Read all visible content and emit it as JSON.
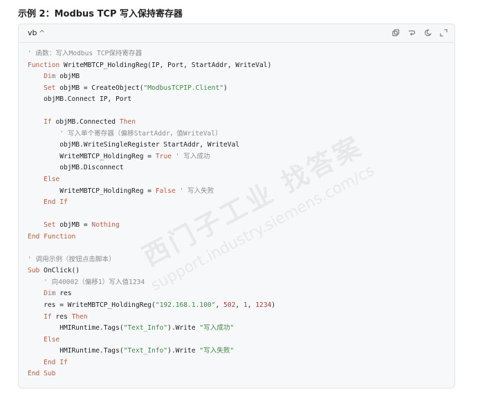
{
  "heading": "示例 2：Modbus TCP 写入保持寄存器",
  "code_block": {
    "language": "vb",
    "collapse_icon": "chevron-up-icon",
    "actions": [
      {
        "name": "copy-icon"
      },
      {
        "name": "wrap-icon"
      },
      {
        "name": "theme-icon"
      },
      {
        "name": "expand-icon"
      }
    ],
    "lines": [
      [
        {
          "t": "' 函数：写入Modbus TCP保持寄存器",
          "c": "cm"
        }
      ],
      [
        {
          "t": "Function",
          "c": "kw"
        },
        {
          "t": " WriteMBTCP_HoldingReg(IP, Port, StartAddr, WriteVal)",
          "c": ""
        }
      ],
      [
        {
          "t": "    ",
          "c": ""
        },
        {
          "t": "Dim",
          "c": "kw"
        },
        {
          "t": " objMB",
          "c": ""
        }
      ],
      [
        {
          "t": "    ",
          "c": ""
        },
        {
          "t": "Set",
          "c": "kw"
        },
        {
          "t": " objMB = CreateObject(",
          "c": ""
        },
        {
          "t": "\"ModbusTCPIP.Client\"",
          "c": "st"
        },
        {
          "t": ")",
          "c": ""
        }
      ],
      [
        {
          "t": "    objMB.Connect IP, Port",
          "c": ""
        }
      ],
      [
        {
          "t": "",
          "c": ""
        }
      ],
      [
        {
          "t": "    ",
          "c": ""
        },
        {
          "t": "If",
          "c": "kw"
        },
        {
          "t": " objMB.Connected ",
          "c": ""
        },
        {
          "t": "Then",
          "c": "kw"
        }
      ],
      [
        {
          "t": "        ' 写入单个寄存器（偏移StartAddr，值WriteVal）",
          "c": "cm"
        }
      ],
      [
        {
          "t": "        objMB.WriteSingleRegister StartAddr, WriteVal",
          "c": ""
        }
      ],
      [
        {
          "t": "        WriteMBTCP_HoldingReg = ",
          "c": ""
        },
        {
          "t": "True",
          "c": "kw"
        },
        {
          "t": " ' 写入成功",
          "c": "cm"
        }
      ],
      [
        {
          "t": "        objMB.Disconnect",
          "c": ""
        }
      ],
      [
        {
          "t": "    ",
          "c": ""
        },
        {
          "t": "Else",
          "c": "kw"
        }
      ],
      [
        {
          "t": "        WriteMBTCP_HoldingReg = ",
          "c": ""
        },
        {
          "t": "False",
          "c": "kw"
        },
        {
          "t": " ' 写入失败",
          "c": "cm"
        }
      ],
      [
        {
          "t": "    ",
          "c": ""
        },
        {
          "t": "End If",
          "c": "kw"
        }
      ],
      [
        {
          "t": "",
          "c": ""
        }
      ],
      [
        {
          "t": "    ",
          "c": ""
        },
        {
          "t": "Set",
          "c": "kw"
        },
        {
          "t": " objMB = ",
          "c": ""
        },
        {
          "t": "Nothing",
          "c": "kw"
        }
      ],
      [
        {
          "t": "End Function",
          "c": "kw"
        }
      ],
      [
        {
          "t": "",
          "c": ""
        }
      ],
      [
        {
          "t": "' 调用示例（按钮点击脚本）",
          "c": "cm"
        }
      ],
      [
        {
          "t": "Sub",
          "c": "kw"
        },
        {
          "t": " OnClick()",
          "c": ""
        }
      ],
      [
        {
          "t": "    ' 向40002（偏移1）写入值1234",
          "c": "cm"
        }
      ],
      [
        {
          "t": "    ",
          "c": ""
        },
        {
          "t": "Dim",
          "c": "kw"
        },
        {
          "t": " res",
          "c": ""
        }
      ],
      [
        {
          "t": "    res = WriteMBTCP_HoldingReg(",
          "c": ""
        },
        {
          "t": "\"192.168.1.100\"",
          "c": "st"
        },
        {
          "t": ", ",
          "c": ""
        },
        {
          "t": "502",
          "c": "nm"
        },
        {
          "t": ", ",
          "c": ""
        },
        {
          "t": "1",
          "c": "nm"
        },
        {
          "t": ", ",
          "c": ""
        },
        {
          "t": "1234",
          "c": "nm"
        },
        {
          "t": ")",
          "c": ""
        }
      ],
      [
        {
          "t": "    ",
          "c": ""
        },
        {
          "t": "If",
          "c": "kw"
        },
        {
          "t": " res ",
          "c": ""
        },
        {
          "t": "Then",
          "c": "kw"
        }
      ],
      [
        {
          "t": "        HMIRuntime.Tags(",
          "c": ""
        },
        {
          "t": "\"Text_Info\"",
          "c": "st"
        },
        {
          "t": ").Write ",
          "c": ""
        },
        {
          "t": "\"写入成功\"",
          "c": "st"
        }
      ],
      [
        {
          "t": "    ",
          "c": ""
        },
        {
          "t": "Else",
          "c": "kw"
        }
      ],
      [
        {
          "t": "        HMIRuntime.Tags(",
          "c": ""
        },
        {
          "t": "\"Text_Info\"",
          "c": "st"
        },
        {
          "t": ").Write ",
          "c": ""
        },
        {
          "t": "\"写入失败\"",
          "c": "st"
        }
      ],
      [
        {
          "t": "    ",
          "c": ""
        },
        {
          "t": "End If",
          "c": "kw"
        }
      ],
      [
        {
          "t": "End Sub",
          "c": "kw"
        }
      ]
    ]
  },
  "watermark": {
    "line1": "西门子工业  找答案",
    "line2": "support.industry.siemens.com/cs"
  },
  "colors": {
    "keyword": "#c45a3e",
    "comment": "#8b8b8b",
    "string": "#3a8a3e",
    "number": "#b23b3b"
  }
}
